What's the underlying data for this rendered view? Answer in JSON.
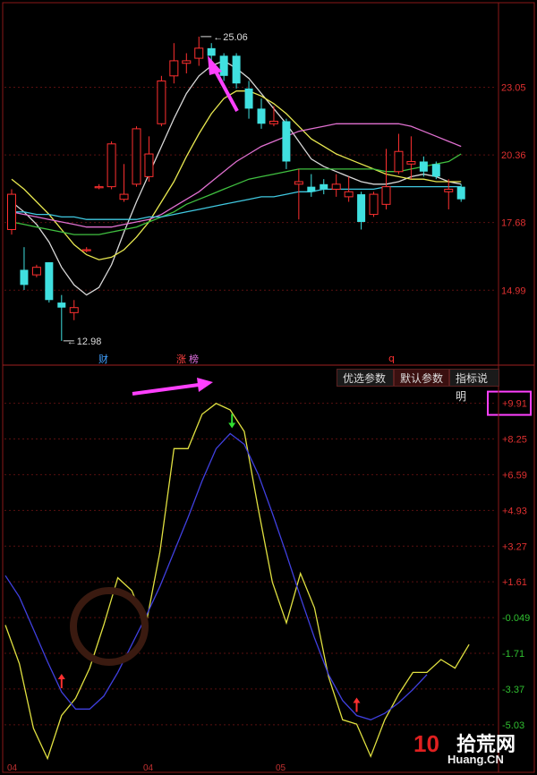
{
  "chart_data": [
    {
      "type": "candlestick",
      "title": "",
      "y_ticks": [
        "23.05",
        "20.36",
        "17.68",
        "14.99"
      ],
      "ylim": [
        12.3,
        26.3
      ],
      "price_annotations": {
        "high": "25.06",
        "low": "12.98"
      },
      "event_markers": [
        "财",
        "涨",
        "榜",
        "q"
      ],
      "candles": [
        {
          "o": 17.4,
          "c": 18.8,
          "h": 19.0,
          "l": 17.2
        },
        {
          "o": 15.8,
          "c": 15.2,
          "h": 16.7,
          "l": 15.0
        },
        {
          "o": 15.6,
          "c": 15.9,
          "h": 16.0,
          "l": 15.5
        },
        {
          "o": 16.1,
          "c": 14.6,
          "h": 16.1,
          "l": 14.5
        },
        {
          "o": 14.5,
          "c": 14.3,
          "h": 14.8,
          "l": 12.98
        },
        {
          "o": 14.1,
          "c": 14.3,
          "h": 14.6,
          "l": 13.8
        },
        {
          "o": 16.6,
          "c": 16.6,
          "h": 16.7,
          "l": 16.5
        },
        {
          "o": 19.1,
          "c": 19.1,
          "h": 19.2,
          "l": 19.0
        },
        {
          "o": 19.1,
          "c": 20.8,
          "h": 20.9,
          "l": 19.0
        },
        {
          "o": 18.6,
          "c": 18.8,
          "h": 20.0,
          "l": 18.5
        },
        {
          "o": 19.2,
          "c": 21.4,
          "h": 21.5,
          "l": 19.1
        },
        {
          "o": 19.5,
          "c": 20.4,
          "h": 21.1,
          "l": 19.3
        },
        {
          "o": 21.6,
          "c": 23.3,
          "h": 23.5,
          "l": 21.5
        },
        {
          "o": 23.5,
          "c": 24.1,
          "h": 24.8,
          "l": 23.2
        },
        {
          "o": 24.0,
          "c": 24.1,
          "h": 24.4,
          "l": 23.6
        },
        {
          "o": 24.2,
          "c": 24.6,
          "h": 25.06,
          "l": 23.9
        },
        {
          "o": 24.6,
          "c": 24.3,
          "h": 24.8,
          "l": 23.9
        },
        {
          "o": 24.3,
          "c": 23.5,
          "h": 24.4,
          "l": 23.3
        },
        {
          "o": 24.3,
          "c": 23.2,
          "h": 24.4,
          "l": 23.0
        },
        {
          "o": 23.0,
          "c": 22.2,
          "h": 23.3,
          "l": 21.8
        },
        {
          "o": 22.2,
          "c": 21.6,
          "h": 22.6,
          "l": 21.4
        },
        {
          "o": 21.6,
          "c": 21.7,
          "h": 22.3,
          "l": 21.5
        },
        {
          "o": 21.7,
          "c": 20.1,
          "h": 21.8,
          "l": 19.8
        },
        {
          "o": 19.2,
          "c": 19.3,
          "h": 19.8,
          "l": 17.8
        },
        {
          "o": 19.1,
          "c": 18.9,
          "h": 19.6,
          "l": 18.7
        },
        {
          "o": 19.2,
          "c": 19.0,
          "h": 19.4,
          "l": 18.8
        },
        {
          "o": 19.0,
          "c": 19.2,
          "h": 19.6,
          "l": 18.7
        },
        {
          "o": 18.7,
          "c": 18.9,
          "h": 19.5,
          "l": 18.5
        },
        {
          "o": 18.8,
          "c": 17.7,
          "h": 18.9,
          "l": 17.4
        },
        {
          "o": 18.0,
          "c": 18.8,
          "h": 18.9,
          "l": 17.9
        },
        {
          "o": 18.4,
          "c": 19.1,
          "h": 20.6,
          "l": 18.2
        },
        {
          "o": 19.7,
          "c": 20.5,
          "h": 21.2,
          "l": 19.6
        },
        {
          "o": 20.0,
          "c": 20.1,
          "h": 21.1,
          "l": 19.4
        },
        {
          "o": 20.1,
          "c": 19.7,
          "h": 20.3,
          "l": 19.5
        },
        {
          "o": 20.0,
          "c": 19.5,
          "h": 20.1,
          "l": 19.4
        },
        {
          "o": 18.9,
          "c": 19.0,
          "h": 19.4,
          "l": 18.2
        },
        {
          "o": 19.1,
          "c": 18.6,
          "h": 19.2,
          "l": 18.5
        }
      ],
      "moving_averages": [
        {
          "color": "#d8d8d8",
          "values": [
            18.5,
            18.1,
            17.6,
            16.9,
            15.9,
            15.2,
            14.8,
            15.1,
            16.0,
            17.3,
            18.5,
            19.6,
            20.7,
            21.8,
            22.8,
            23.5,
            23.9,
            24.1,
            23.8,
            23.4,
            22.8,
            22.2,
            21.6,
            20.9,
            20.2,
            19.9,
            19.7,
            19.5,
            19.3,
            19.2,
            19.2,
            19.3,
            19.5,
            19.6,
            19.5,
            19.3,
            19.2
          ]
        },
        {
          "color": "#e8e850",
          "values": [
            19.4,
            19.0,
            18.5,
            18.0,
            17.4,
            16.8,
            16.4,
            16.2,
            16.3,
            16.6,
            17.1,
            17.7,
            18.5,
            19.3,
            20.3,
            21.2,
            22.0,
            22.6,
            22.9,
            22.9,
            22.7,
            22.4,
            22.0,
            21.5,
            21.0,
            20.7,
            20.4,
            20.2,
            20.0,
            19.8,
            19.6,
            19.5,
            19.4,
            19.4,
            19.3,
            19.3,
            19.3
          ]
        },
        {
          "color": "#e070d0",
          "values": [
            18.1,
            18.0,
            17.9,
            17.8,
            17.7,
            17.6,
            17.5,
            17.5,
            17.5,
            17.6,
            17.7,
            17.8,
            18.0,
            18.3,
            18.6,
            18.9,
            19.3,
            19.7,
            20.1,
            20.4,
            20.7,
            20.9,
            21.1,
            21.3,
            21.4,
            21.5,
            21.6,
            21.6,
            21.6,
            21.6,
            21.6,
            21.6,
            21.5,
            21.3,
            21.1,
            20.9,
            20.7
          ]
        },
        {
          "color": "#40c040",
          "values": [
            17.7,
            17.6,
            17.5,
            17.4,
            17.3,
            17.2,
            17.2,
            17.2,
            17.3,
            17.4,
            17.5,
            17.7,
            17.9,
            18.1,
            18.4,
            18.6,
            18.8,
            19.0,
            19.2,
            19.4,
            19.5,
            19.6,
            19.7,
            19.8,
            19.8,
            19.8,
            19.8,
            19.8,
            19.8,
            19.8,
            19.7,
            19.7,
            19.8,
            19.9,
            20.0,
            20.1,
            20.4
          ]
        },
        {
          "color": "#40c8e0",
          "values": [
            18.1,
            18.1,
            18.0,
            18.0,
            17.9,
            17.9,
            17.8,
            17.8,
            17.8,
            17.8,
            17.8,
            17.9,
            17.9,
            18.0,
            18.1,
            18.2,
            18.3,
            18.4,
            18.5,
            18.6,
            18.7,
            18.7,
            18.8,
            18.9,
            18.9,
            19.0,
            19.0,
            19.0,
            19.0,
            19.0,
            19.1,
            19.1,
            19.1,
            19.1,
            19.1,
            19.1,
            19.1
          ]
        }
      ]
    },
    {
      "type": "line",
      "y_ticks": [
        "+9.91",
        "+8.25",
        "+6.59",
        "+4.93",
        "+3.27",
        "+1.61",
        "-0.049",
        "-1.71",
        "-3.37",
        "-5.03"
      ],
      "ylim": [
        -6.7,
        10.6
      ],
      "buttons": [
        "优选参数",
        "默认参数",
        "指标说明"
      ],
      "series": [
        {
          "color": "#e0e040",
          "values": [
            -0.4,
            -2.2,
            -5.2,
            -6.6,
            -4.6,
            -3.8,
            -2.4,
            -0.4,
            1.8,
            1.2,
            -0.4,
            3.0,
            7.8,
            7.8,
            9.4,
            9.9,
            9.6,
            8.6,
            5.0,
            1.6,
            -0.3,
            2.0,
            0.4,
            -2.8,
            -4.8,
            -5.0,
            -6.5,
            -4.8,
            -3.6,
            -2.6,
            -2.6,
            -2.0,
            -2.4,
            -1.3
          ]
        },
        {
          "color": "#4040e0",
          "values": [
            1.9,
            0.9,
            -0.6,
            -2.1,
            -3.5,
            -4.3,
            -4.3,
            -3.7,
            -2.6,
            -1.3,
            0.0,
            1.4,
            3.0,
            4.6,
            6.3,
            7.8,
            8.5,
            8.0,
            6.6,
            4.8,
            2.9,
            0.9,
            -1.0,
            -2.7,
            -3.9,
            -4.6,
            -4.8,
            -4.5,
            -4.0,
            -3.4,
            -2.7
          ]
        }
      ],
      "signals": [
        {
          "kind": "buy",
          "color": "#ff3030",
          "x_index": 4
        },
        {
          "kind": "sell",
          "color": "#30e030",
          "x_index": 16
        },
        {
          "kind": "buy",
          "color": "#ff3030",
          "x_index": 25
        }
      ],
      "date_labels": [
        "04",
        "04",
        "05"
      ],
      "watermark": {
        "num": "10",
        "cn": "拾荒网",
        "url": "Huang.CN"
      }
    }
  ]
}
